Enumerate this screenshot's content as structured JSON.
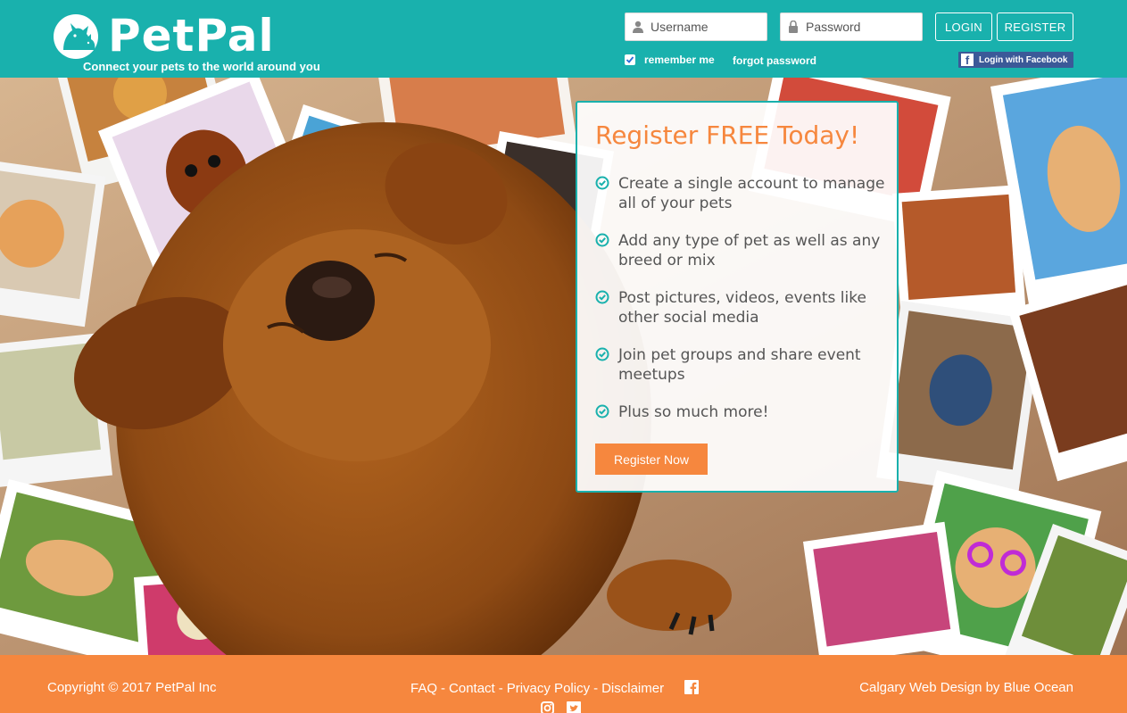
{
  "header": {
    "logo_text": "PetPal",
    "tagline": "Connect your pets to the world around you",
    "username_placeholder": "Username",
    "password_placeholder": "Password",
    "login_label": "LOGIN",
    "register_label": "REGISTER",
    "remember_label": "remember me",
    "remember_checked": true,
    "forgot_label": "forgot password",
    "facebook_login_label": "Login with Facebook"
  },
  "register_card": {
    "title": "Register FREE Today!",
    "features": [
      "Create a single account to manage all of your pets",
      "Add any type of pet as well as any breed or mix",
      "Post pictures, videos, events like other social media",
      "Join pet groups and share event meetups",
      "Plus so much more!"
    ],
    "button_label": "Register Now"
  },
  "footer": {
    "copyright": "Copyright © 2017 PetPal Inc",
    "links": [
      "FAQ",
      "Contact",
      "Privacy Policy",
      "Disclaimer"
    ],
    "link_separator": "-",
    "credit": "Calgary Web Design by Blue Ocean"
  },
  "colors": {
    "header_teal": "#19b1ad",
    "accent_orange": "#f6873e",
    "facebook_blue": "#3b5998"
  },
  "icons": {
    "user_field": "user-icon",
    "password_field": "lock-icon",
    "feature_bullets": "check-circle-icon",
    "footer_social": [
      "facebook-icon",
      "instagram-icon",
      "twitter-icon"
    ]
  }
}
